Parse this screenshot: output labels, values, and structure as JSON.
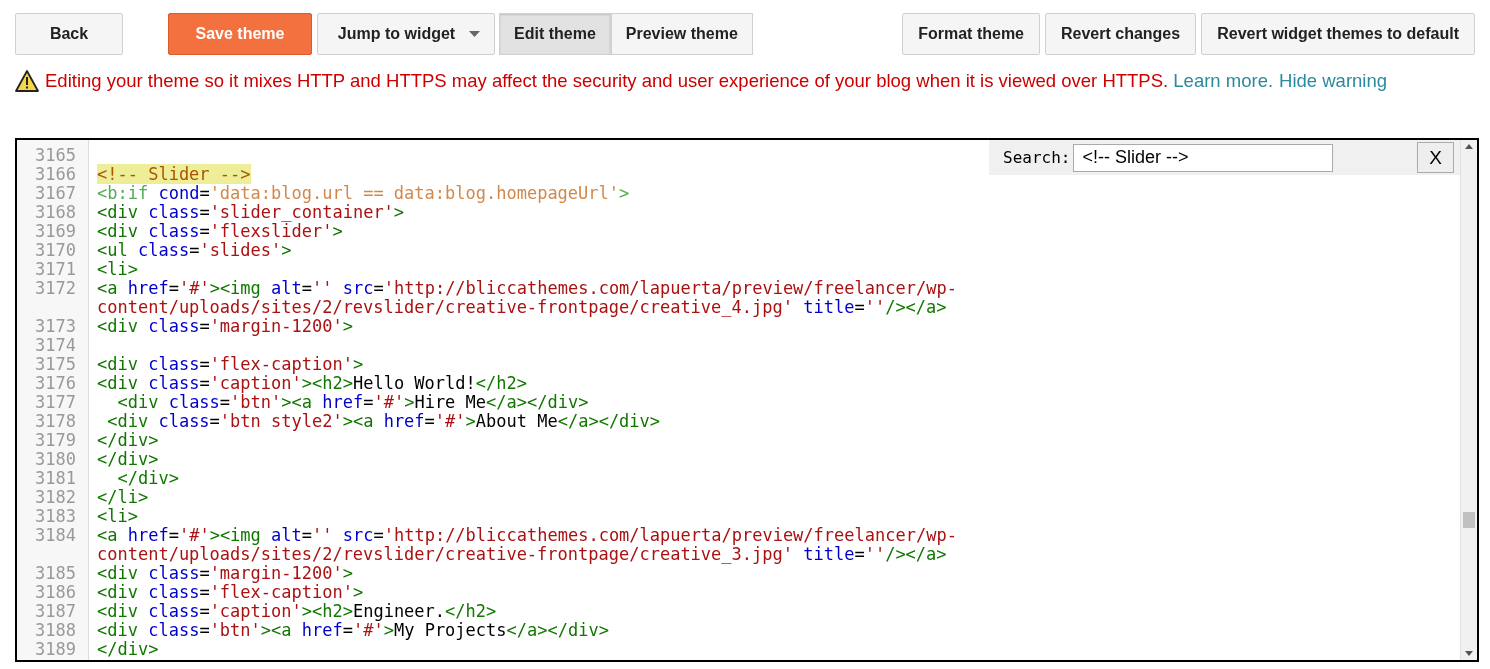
{
  "toolbar": {
    "buttons": [
      {
        "label": "Back",
        "kind": "plain"
      },
      {
        "label": "Save theme",
        "kind": "primary"
      },
      {
        "label": "Jump to widget",
        "kind": "dropdown"
      }
    ],
    "view_tabs": [
      {
        "label": "Edit theme",
        "selected": true
      },
      {
        "label": "Preview theme",
        "selected": false
      }
    ],
    "right_buttons": [
      "Format theme",
      "Revert changes",
      "Revert widget themes to default"
    ]
  },
  "warning": {
    "message": "Editing your theme so it mixes HTTP and HTTPS may affect the security and user experience of your blog when it is viewed over HTTPS.",
    "learn_more": "Learn more",
    "separator": ".",
    "hide": "Hide warning"
  },
  "search": {
    "label": "Search:",
    "value": "<!-- Slider -->",
    "close": "X"
  },
  "editor": {
    "lines": [
      {
        "number": "3165"
      },
      {
        "number": "3166",
        "highlighted": true,
        "tokens": [
          {
            "kind": "comment",
            "text": "<!-- Slider -->"
          }
        ]
      },
      {
        "number": "3167",
        "highlighted": false,
        "tokens": [
          {
            "kind": "btag",
            "text": "<b:if"
          },
          {
            "kind": "attr",
            "text": " cond"
          },
          {
            "kind": "txt",
            "text": "="
          },
          {
            "kind": "cond",
            "text": "'data:blog.url == data:blog.homepageUrl'"
          },
          {
            "kind": "btag",
            "text": ">"
          }
        ]
      },
      {
        "number": "3168",
        "highlighted": false,
        "tokens": [
          {
            "kind": "tag",
            "text": "<div"
          },
          {
            "kind": "attr",
            "text": " class"
          },
          {
            "kind": "txt",
            "text": "="
          },
          {
            "kind": "str",
            "text": "'slider_container'"
          },
          {
            "kind": "tag",
            "text": ">"
          }
        ]
      },
      {
        "number": "3169",
        "highlighted": false,
        "tokens": [
          {
            "kind": "tag",
            "text": "<div"
          },
          {
            "kind": "attr",
            "text": " class"
          },
          {
            "kind": "txt",
            "text": "="
          },
          {
            "kind": "str",
            "text": "'flexslider'"
          },
          {
            "kind": "tag",
            "text": ">"
          }
        ]
      },
      {
        "number": "3170",
        "highlighted": false,
        "tokens": [
          {
            "kind": "tag",
            "text": "<ul"
          },
          {
            "kind": "attr",
            "text": " class"
          },
          {
            "kind": "txt",
            "text": "="
          },
          {
            "kind": "str",
            "text": "'slides'"
          },
          {
            "kind": "tag",
            "text": ">"
          }
        ]
      },
      {
        "number": "3171",
        "highlighted": false,
        "tokens": [
          {
            "kind": "tag",
            "text": "<li>"
          }
        ]
      },
      {
        "number": "3172",
        "highlighted": false,
        "tokens": [
          {
            "kind": "tag",
            "text": "<a"
          },
          {
            "kind": "attr",
            "text": " href"
          },
          {
            "kind": "txt",
            "text": "="
          },
          {
            "kind": "str",
            "text": "'#'"
          },
          {
            "kind": "tag",
            "text": "><img"
          },
          {
            "kind": "attr",
            "text": " alt"
          },
          {
            "kind": "txt",
            "text": "="
          },
          {
            "kind": "str",
            "text": "''"
          },
          {
            "kind": "attr",
            "text": " src"
          },
          {
            "kind": "txt",
            "text": "="
          },
          {
            "kind": "str",
            "text": "'http://bliccathemes.com/lapuerta/preview/freelancer/wp-"
          }
        ],
        "continuation": [
          {
            "kind": "str",
            "text": "content/uploads/sites/2/revslider/creative-frontpage/creative_4.jpg'"
          },
          {
            "kind": "attr",
            "text": " title"
          },
          {
            "kind": "txt",
            "text": "="
          },
          {
            "kind": "str",
            "text": "''"
          },
          {
            "kind": "tag",
            "text": "/></a>"
          }
        ]
      },
      {
        "number": "3173",
        "highlighted": false,
        "tokens": [
          {
            "kind": "tag",
            "text": "<div"
          },
          {
            "kind": "attr",
            "text": " class"
          },
          {
            "kind": "txt",
            "text": "="
          },
          {
            "kind": "str",
            "text": "'margin-1200'"
          },
          {
            "kind": "tag",
            "text": ">"
          }
        ]
      },
      {
        "number": "3174"
      },
      {
        "number": "3175",
        "highlighted": false,
        "tokens": [
          {
            "kind": "tag",
            "text": "<div"
          },
          {
            "kind": "attr",
            "text": " class"
          },
          {
            "kind": "txt",
            "text": "="
          },
          {
            "kind": "str",
            "text": "'flex-caption'"
          },
          {
            "kind": "tag",
            "text": ">"
          }
        ]
      },
      {
        "number": "3176",
        "highlighted": false,
        "tokens": [
          {
            "kind": "tag",
            "text": "<div"
          },
          {
            "kind": "attr",
            "text": " class"
          },
          {
            "kind": "txt",
            "text": "="
          },
          {
            "kind": "str",
            "text": "'caption'"
          },
          {
            "kind": "tag",
            "text": "><h2>"
          },
          {
            "kind": "txt",
            "text": "Hello World!"
          },
          {
            "kind": "tag",
            "text": "</h2>"
          }
        ]
      },
      {
        "number": "3177",
        "highlighted": false,
        "tokens": [
          {
            "kind": "tag",
            "text": "  <div"
          },
          {
            "kind": "attr",
            "text": " class"
          },
          {
            "kind": "txt",
            "text": "="
          },
          {
            "kind": "str",
            "text": "'btn'"
          },
          {
            "kind": "tag",
            "text": "><a"
          },
          {
            "kind": "attr",
            "text": " href"
          },
          {
            "kind": "txt",
            "text": "="
          },
          {
            "kind": "str",
            "text": "'#'"
          },
          {
            "kind": "tag",
            "text": ">"
          },
          {
            "kind": "txt",
            "text": "Hire Me"
          },
          {
            "kind": "tag",
            "text": "</a></div>"
          }
        ]
      },
      {
        "number": "3178",
        "highlighted": false,
        "tokens": [
          {
            "kind": "tag",
            "text": " <div"
          },
          {
            "kind": "attr",
            "text": " class"
          },
          {
            "kind": "txt",
            "text": "="
          },
          {
            "kind": "str",
            "text": "'btn style2'"
          },
          {
            "kind": "tag",
            "text": "><a"
          },
          {
            "kind": "attr",
            "text": " href"
          },
          {
            "kind": "txt",
            "text": "="
          },
          {
            "kind": "str",
            "text": "'#'"
          },
          {
            "kind": "tag",
            "text": ">"
          },
          {
            "kind": "txt",
            "text": "About Me"
          },
          {
            "kind": "tag",
            "text": "</a></div>"
          }
        ]
      },
      {
        "number": "3179",
        "highlighted": false,
        "tokens": [
          {
            "kind": "tag",
            "text": "</div>"
          }
        ]
      },
      {
        "number": "3180",
        "highlighted": false,
        "tokens": [
          {
            "kind": "tag",
            "text": "</div>"
          }
        ]
      },
      {
        "number": "3181",
        "highlighted": false,
        "tokens": [
          {
            "kind": "tag",
            "text": "  </div>"
          }
        ]
      },
      {
        "number": "3182",
        "highlighted": false,
        "tokens": [
          {
            "kind": "tag",
            "text": "</li>"
          }
        ]
      },
      {
        "number": "3183",
        "highlighted": false,
        "tokens": [
          {
            "kind": "tag",
            "text": "<li>"
          }
        ]
      },
      {
        "number": "3184",
        "highlighted": false,
        "tokens": [
          {
            "kind": "tag",
            "text": "<a"
          },
          {
            "kind": "attr",
            "text": " href"
          },
          {
            "kind": "txt",
            "text": "="
          },
          {
            "kind": "str",
            "text": "'#'"
          },
          {
            "kind": "tag",
            "text": "><img"
          },
          {
            "kind": "attr",
            "text": " alt"
          },
          {
            "kind": "txt",
            "text": "="
          },
          {
            "kind": "str",
            "text": "''"
          },
          {
            "kind": "attr",
            "text": " src"
          },
          {
            "kind": "txt",
            "text": "="
          },
          {
            "kind": "str",
            "text": "'http://bliccathemes.com/lapuerta/preview/freelancer/wp-"
          }
        ],
        "continuation": [
          {
            "kind": "str",
            "text": "content/uploads/sites/2/revslider/creative-frontpage/creative_3.jpg'"
          },
          {
            "kind": "attr",
            "text": " title"
          },
          {
            "kind": "txt",
            "text": "="
          },
          {
            "kind": "str",
            "text": "''"
          },
          {
            "kind": "tag",
            "text": "/></a>"
          }
        ]
      },
      {
        "number": "3185",
        "highlighted": false,
        "tokens": [
          {
            "kind": "tag",
            "text": "<div"
          },
          {
            "kind": "attr",
            "text": " class"
          },
          {
            "kind": "txt",
            "text": "="
          },
          {
            "kind": "str",
            "text": "'margin-1200'"
          },
          {
            "kind": "tag",
            "text": ">"
          }
        ]
      },
      {
        "number": "3186",
        "highlighted": false,
        "tokens": [
          {
            "kind": "tag",
            "text": "<div"
          },
          {
            "kind": "attr",
            "text": " class"
          },
          {
            "kind": "txt",
            "text": "="
          },
          {
            "kind": "str",
            "text": "'flex-caption'"
          },
          {
            "kind": "tag",
            "text": ">"
          }
        ]
      },
      {
        "number": "3187",
        "highlighted": false,
        "tokens": [
          {
            "kind": "tag",
            "text": "<div"
          },
          {
            "kind": "attr",
            "text": " class"
          },
          {
            "kind": "txt",
            "text": "="
          },
          {
            "kind": "str",
            "text": "'caption'"
          },
          {
            "kind": "tag",
            "text": "><h2>"
          },
          {
            "kind": "txt",
            "text": "Engineer."
          },
          {
            "kind": "tag",
            "text": "</h2>"
          }
        ]
      },
      {
        "number": "3188",
        "highlighted": false,
        "tokens": [
          {
            "kind": "tag",
            "text": "<div"
          },
          {
            "kind": "attr",
            "text": " class"
          },
          {
            "kind": "txt",
            "text": "="
          },
          {
            "kind": "str",
            "text": "'btn'"
          },
          {
            "kind": "tag",
            "text": "><a"
          },
          {
            "kind": "attr",
            "text": " href"
          },
          {
            "kind": "txt",
            "text": "="
          },
          {
            "kind": "str",
            "text": "'#'"
          },
          {
            "kind": "tag",
            "text": ">"
          },
          {
            "kind": "txt",
            "text": "My Projects"
          },
          {
            "kind": "tag",
            "text": "</a></div>"
          }
        ]
      },
      {
        "number": "3189",
        "highlighted": false,
        "tokens": [
          {
            "kind": "tag",
            "text": "</div>"
          }
        ]
      }
    ]
  }
}
